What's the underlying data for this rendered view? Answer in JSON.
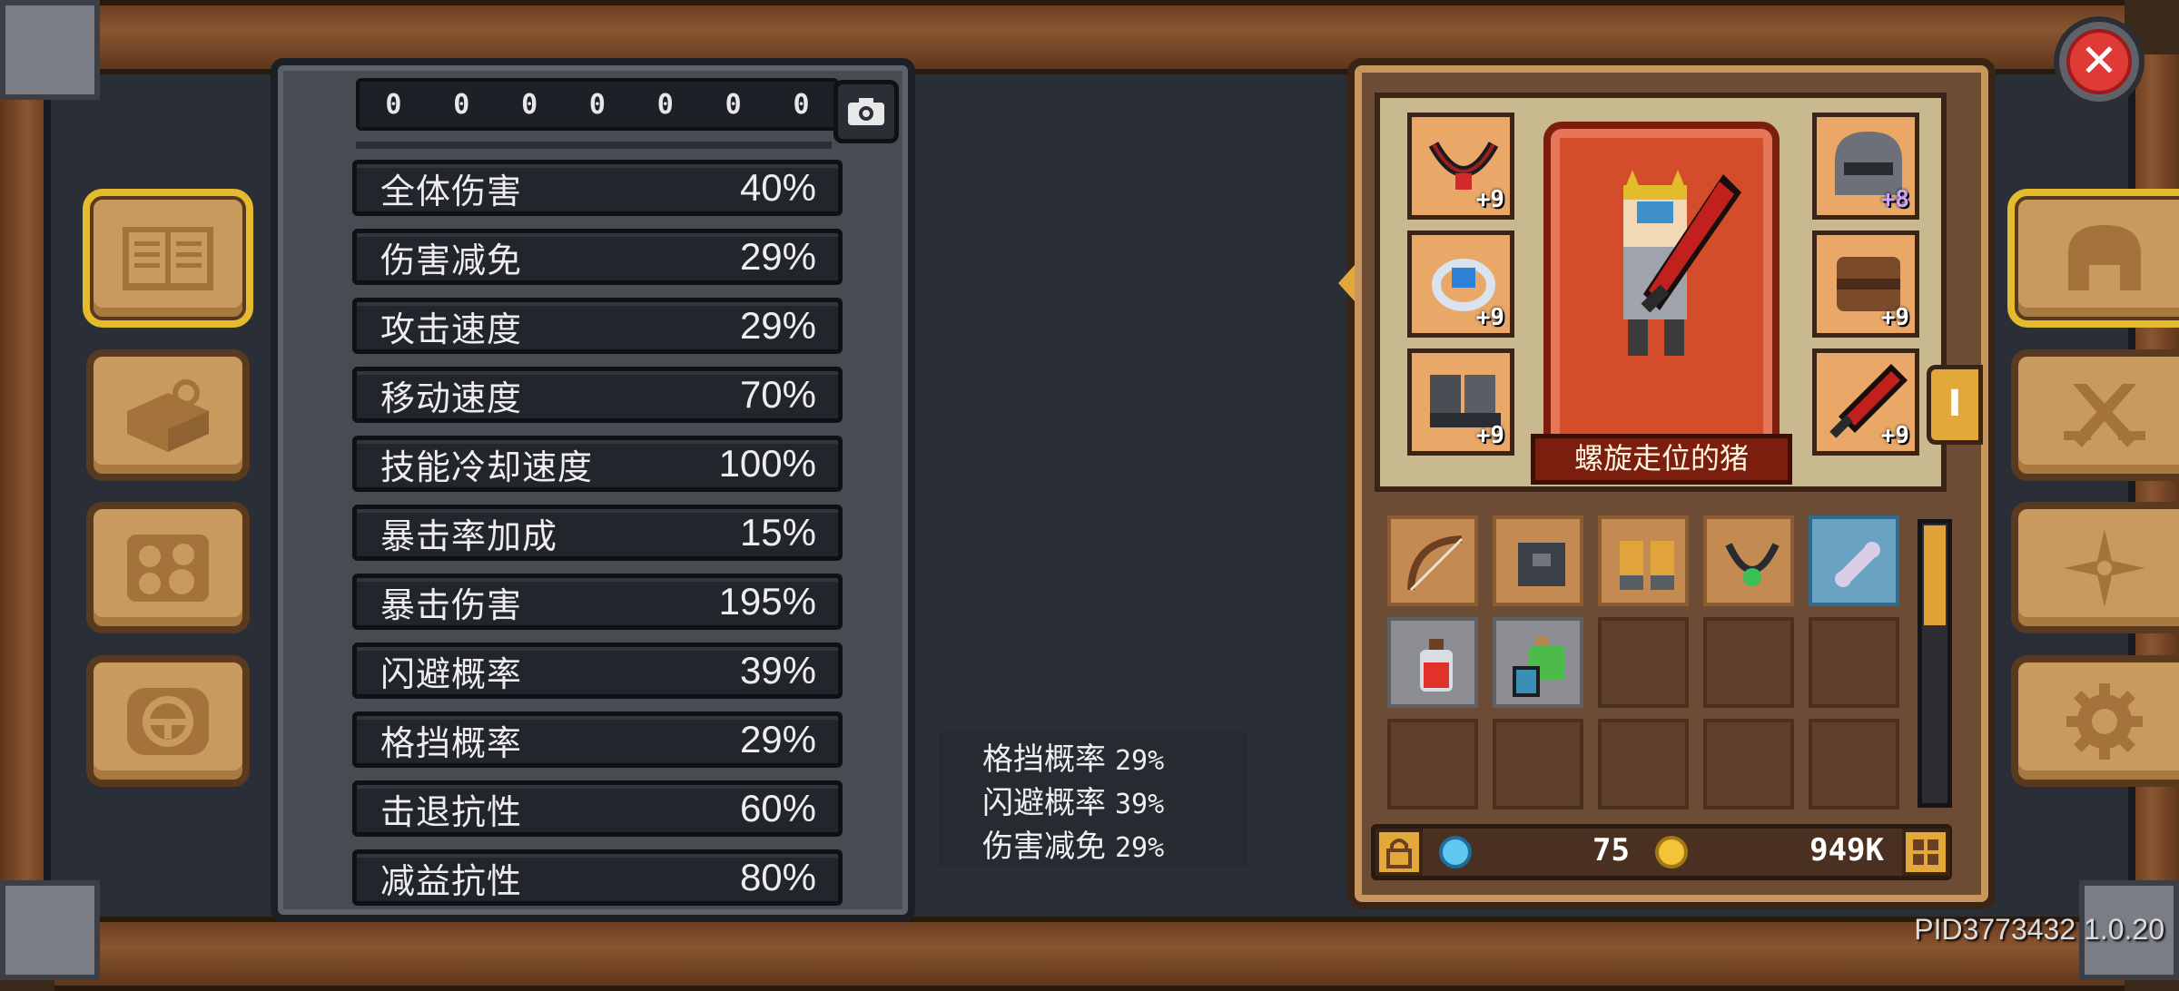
{
  "uid_digits": [
    "0",
    "0",
    "0",
    "0",
    "0",
    "0",
    "0"
  ],
  "stats": [
    {
      "label": "全体伤害",
      "value": "40%"
    },
    {
      "label": "伤害减免",
      "value": "29%"
    },
    {
      "label": "攻击速度",
      "value": "29%"
    },
    {
      "label": "移动速度",
      "value": "70%"
    },
    {
      "label": "技能冷却速度",
      "value": "100%"
    },
    {
      "label": "暴击率加成",
      "value": "15%"
    },
    {
      "label": "暴击伤害",
      "value": "195%"
    },
    {
      "label": "闪避概率",
      "value": "39%"
    },
    {
      "label": "格挡概率",
      "value": "29%"
    },
    {
      "label": "击退抗性",
      "value": "60%"
    },
    {
      "label": "减益抗性",
      "value": "80%"
    }
  ],
  "tooltip": [
    {
      "label": "格挡概率",
      "value": "29%"
    },
    {
      "label": "闪避概率",
      "value": "39%"
    },
    {
      "label": "伤害减免",
      "value": "29%"
    }
  ],
  "character": {
    "name": "螺旋走位的猪",
    "side_tab_label": "I"
  },
  "equipment": {
    "amulet": {
      "icon": "necklace-icon",
      "level": "+9"
    },
    "ring": {
      "icon": "ring-icon",
      "level": "+9"
    },
    "boots": {
      "icon": "boots-icon",
      "level": "+9"
    },
    "helmet": {
      "icon": "helmet-icon",
      "level": "+8"
    },
    "armor": {
      "icon": "armor-icon",
      "level": "+9"
    },
    "weapon": {
      "icon": "sword-icon",
      "level": "+9"
    }
  },
  "inventory": [
    {
      "icon": "bow-icon",
      "state": "filled"
    },
    {
      "icon": "book-icon",
      "state": "filled"
    },
    {
      "icon": "gauntlets-icon",
      "state": "filled"
    },
    {
      "icon": "emerald-necklace-icon",
      "state": "filled"
    },
    {
      "icon": "bone-icon",
      "state": "selected"
    },
    {
      "icon": "red-potion-icon",
      "state": "grey"
    },
    {
      "icon": "green-potion-icon",
      "state": "grey"
    }
  ],
  "currency": {
    "gems": "75",
    "gold": "949K",
    "gold_suffix_color": "#e03a36"
  },
  "left_nav": [
    "book-icon",
    "scroll-map-icon",
    "skills-icon",
    "bell-icon"
  ],
  "right_nav": [
    "helmet-icon",
    "crossed-swords-icon",
    "sparkle-icon",
    "gear-icon"
  ],
  "version": "PID3773432 1.0.20",
  "colors": {
    "accent": "#e3bb2c",
    "panel": "#474b52",
    "wood": "#8a5530",
    "close": "#e03a36"
  }
}
